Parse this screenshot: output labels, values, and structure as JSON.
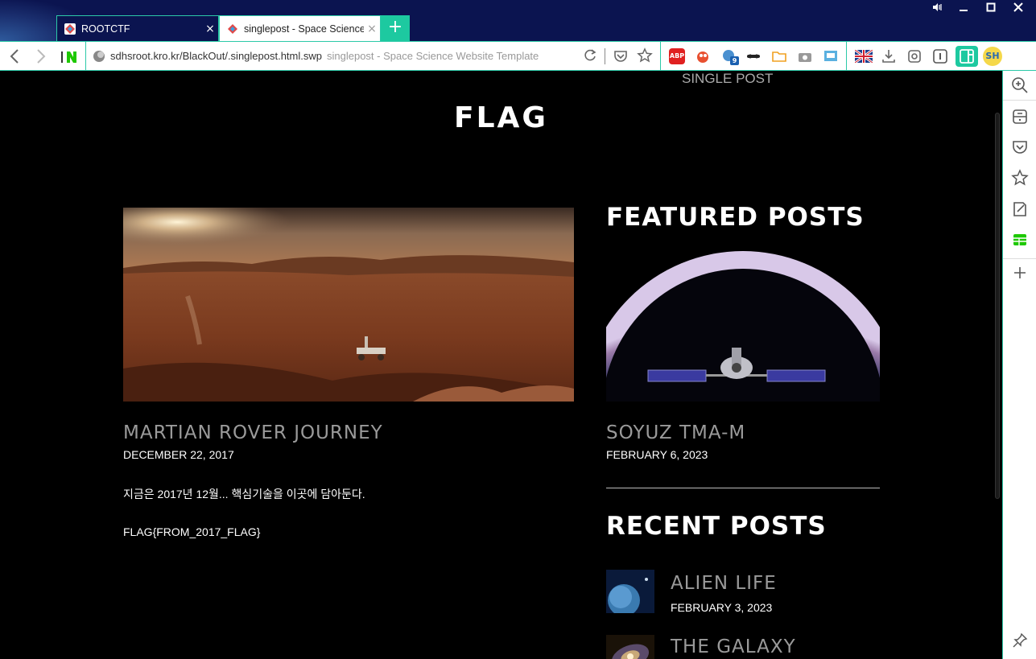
{
  "browser": {
    "tabs": [
      {
        "label": "ROOTCTF",
        "close": "×"
      },
      {
        "label": "singlepost - Space Science",
        "close": "×"
      }
    ],
    "new_tab": "+",
    "url": "sdhsroot.kro.kr/BlackOut/.singlepost.html.swp",
    "page_title": "singlepost - Space Science Website Template",
    "ext_badge": "9",
    "profile_initials": "SH",
    "colors": {
      "accent": "#1dc9a0",
      "titlebar": "#0b1450"
    }
  },
  "page": {
    "breadcrumb": "SINGLE POST",
    "title": "FLAG",
    "post": {
      "title": "MARTIAN ROVER JOURNEY",
      "date": "DECEMBER 22, 2017",
      "text": "지금은 2017년 12월... 핵심기술을 이곳에 담아둔다.",
      "flag": "FLAG{FROM_2017_FLAG}"
    },
    "featured_heading": "FEATURED POSTS",
    "featured": {
      "title": "SOYUZ TMA-M",
      "date": "FEBRUARY 6, 2023"
    },
    "recent_heading": "RECENT POSTS",
    "recent": [
      {
        "title": "ALIEN LIFE",
        "date": "FEBRUARY 3, 2023"
      },
      {
        "title": "THE GALAXY",
        "date": ""
      }
    ]
  }
}
